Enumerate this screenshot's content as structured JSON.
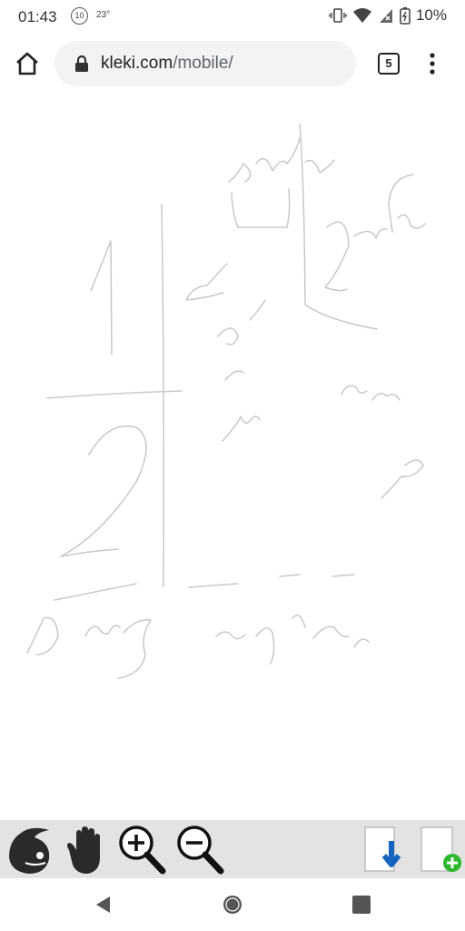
{
  "status_bar": {
    "time": "01:43",
    "notification_badge": "10",
    "temperature": "23°",
    "battery": "10%",
    "icons": [
      "vibrate-icon",
      "wifi-icon",
      "signal-icon",
      "battery-icon"
    ]
  },
  "browser": {
    "url_domain": "kleki.com",
    "url_path": "/mobile/",
    "tab_count": "5",
    "icons": [
      "home-icon",
      "lock-icon",
      "overflow-menu-icon"
    ]
  },
  "toolbar": {
    "left_tools": [
      "brush-logo-icon",
      "hand-pan-icon",
      "zoom-in-icon",
      "zoom-out-icon"
    ],
    "right_tools": [
      "download-icon",
      "new-page-icon"
    ],
    "accent_download": "#1565c0",
    "accent_new": "#2eb82e"
  },
  "nav": {
    "icons": [
      "back-icon",
      "home-circle-icon",
      "recents-icon"
    ]
  },
  "canvas": {
    "stroke_color": "#c8c8c8",
    "background": "#ffffff"
  }
}
